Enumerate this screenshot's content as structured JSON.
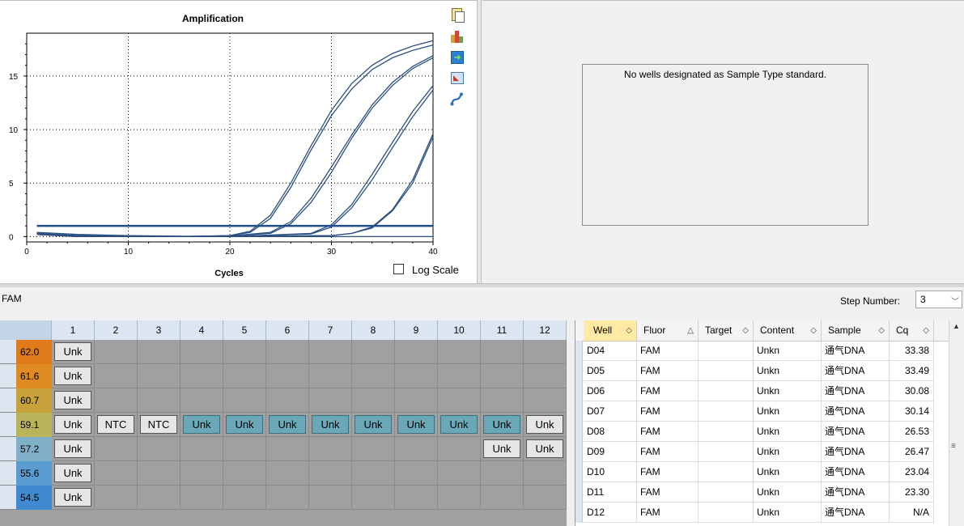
{
  "chart": {
    "title": "Amplification",
    "xlabel": "Cycles",
    "log_scale_label": "Log Scale",
    "log_scale_checked": false,
    "toolbar_icons": [
      "copy-icon",
      "chart-color-icon",
      "export-icon",
      "image-export-icon",
      "curve-tools-icon"
    ]
  },
  "chart_data": {
    "type": "line",
    "title": "Amplification",
    "xlabel": "Cycles",
    "ylabel": "",
    "xlim": [
      0,
      40
    ],
    "ylim": [
      -0.5,
      19
    ],
    "x_ticks": [
      "0",
      "10",
      "20",
      "30",
      "40"
    ],
    "y_ticks": [
      "0",
      "5",
      "10",
      "15"
    ],
    "grid": true,
    "log_scale": false,
    "threshold": 1.0,
    "line_color": "#2b4f7e",
    "series": [
      {
        "x": [
          1,
          5,
          10,
          15,
          20,
          22,
          24,
          26,
          28,
          30,
          32,
          34,
          36,
          38,
          40
        ],
        "y": [
          0.3,
          0.1,
          0,
          0,
          0.1,
          0.5,
          2.0,
          5.0,
          8.5,
          11.8,
          14.3,
          16.0,
          17.1,
          17.8,
          18.3
        ]
      },
      {
        "x": [
          1,
          5,
          10,
          15,
          20,
          22,
          24,
          26,
          28,
          30,
          32,
          34,
          36,
          38,
          40
        ],
        "y": [
          0.3,
          0.1,
          0,
          0,
          0.1,
          0.4,
          1.7,
          4.6,
          8.1,
          11.3,
          13.8,
          15.6,
          16.7,
          17.4,
          17.9
        ]
      },
      {
        "x": [
          1,
          5,
          10,
          15,
          20,
          24,
          26,
          28,
          30,
          32,
          34,
          36,
          38,
          40
        ],
        "y": [
          0.2,
          0.1,
          0,
          0,
          0.05,
          0.4,
          1.4,
          3.6,
          6.5,
          9.5,
          12.3,
          14.4,
          15.9,
          16.9
        ]
      },
      {
        "x": [
          1,
          5,
          10,
          15,
          20,
          24,
          26,
          28,
          30,
          32,
          34,
          36,
          38,
          40
        ],
        "y": [
          0.2,
          0.1,
          0,
          0,
          0.05,
          0.3,
          1.2,
          3.2,
          6.0,
          9.2,
          12.0,
          14.1,
          15.7,
          16.7
        ]
      },
      {
        "x": [
          1,
          5,
          10,
          15,
          20,
          28,
          30,
          32,
          34,
          36,
          38,
          40
        ],
        "y": [
          0.2,
          0,
          0,
          0,
          0,
          0.3,
          1.1,
          3.0,
          5.8,
          8.8,
          11.7,
          14.1
        ]
      },
      {
        "x": [
          1,
          5,
          10,
          15,
          20,
          28,
          30,
          32,
          34,
          36,
          38,
          40
        ],
        "y": [
          0.2,
          0,
          0,
          0,
          0,
          0.25,
          0.9,
          2.7,
          5.3,
          8.3,
          11.2,
          13.7
        ]
      },
      {
        "x": [
          1,
          5,
          10,
          15,
          20,
          30,
          32,
          34,
          36,
          38,
          40
        ],
        "y": [
          0.2,
          0,
          0,
          0,
          0,
          0.1,
          0.3,
          0.9,
          2.5,
          5.3,
          9.6
        ]
      },
      {
        "x": [
          1,
          5,
          10,
          15,
          20,
          30,
          32,
          34,
          36,
          38,
          40
        ],
        "y": [
          0.2,
          0,
          0,
          0,
          0,
          0.1,
          0.3,
          0.8,
          2.4,
          5.0,
          9.3
        ]
      },
      {
        "x": [
          1,
          5,
          10,
          20,
          30,
          40
        ],
        "y": [
          0.4,
          0.2,
          0.1,
          0,
          0,
          0
        ]
      }
    ]
  },
  "standard_pane": {
    "message": "No wells designated as Sample Type standard."
  },
  "fluor_bar": {
    "fluor": "FAM",
    "step_label": "Step Number:",
    "step_value": "3"
  },
  "plate": {
    "columns": [
      "1",
      "2",
      "3",
      "4",
      "5",
      "6",
      "7",
      "8",
      "9",
      "10",
      "11",
      "12"
    ],
    "rows": [
      {
        "temp": "62.0",
        "color": "#e07b1a",
        "wells": [
          "Unk",
          "",
          "",
          "",
          "",
          "",
          "",
          "",
          "",
          "",
          "",
          ""
        ]
      },
      {
        "temp": "61.6",
        "color": "#e08a22",
        "wells": [
          "Unk",
          "",
          "",
          "",
          "",
          "",
          "",
          "",
          "",
          "",
          "",
          ""
        ]
      },
      {
        "temp": "60.7",
        "color": "#c7a23a",
        "wells": [
          "Unk",
          "",
          "",
          "",
          "",
          "",
          "",
          "",
          "",
          "",
          "",
          ""
        ]
      },
      {
        "temp": "59.1",
        "color": "#b9b45a",
        "wells": [
          "Unk",
          "NTC",
          "NTC",
          "Unk",
          "Unk",
          "Unk",
          "Unk",
          "Unk",
          "Unk",
          "Unk",
          "Unk",
          "Unk"
        ]
      },
      {
        "temp": "57.2",
        "color": "#7fb0c8",
        "wells": [
          "Unk",
          "",
          "",
          "",
          "",
          "",
          "",
          "",
          "",
          "",
          "Unk",
          "Unk"
        ]
      },
      {
        "temp": "55.6",
        "color": "#5a9ccf",
        "wells": [
          "Unk",
          "",
          "",
          "",
          "",
          "",
          "",
          "",
          "",
          "",
          "",
          ""
        ]
      },
      {
        "temp": "54.5",
        "color": "#3f8ad0",
        "wells": [
          "Unk",
          "",
          "",
          "",
          "",
          "",
          "",
          "",
          "",
          "",
          "",
          ""
        ]
      }
    ],
    "blue_wells_row4": [
      3,
      4,
      5,
      6,
      7,
      8,
      9,
      10
    ]
  },
  "results_table": {
    "columns": [
      "Well",
      "Fluor",
      "Target",
      "Content",
      "Sample",
      "Cq"
    ],
    "rows": [
      [
        "D04",
        "FAM",
        "",
        "Unkn",
        "通气DNA",
        "33.38"
      ],
      [
        "D05",
        "FAM",
        "",
        "Unkn",
        "通气DNA",
        "33.49"
      ],
      [
        "D06",
        "FAM",
        "",
        "Unkn",
        "通气DNA",
        "30.08"
      ],
      [
        "D07",
        "FAM",
        "",
        "Unkn",
        "通气DNA",
        "30.14"
      ],
      [
        "D08",
        "FAM",
        "",
        "Unkn",
        "通气DNA",
        "26.53"
      ],
      [
        "D09",
        "FAM",
        "",
        "Unkn",
        "通气DNA",
        "26.47"
      ],
      [
        "D10",
        "FAM",
        "",
        "Unkn",
        "通气DNA",
        "23.04"
      ],
      [
        "D11",
        "FAM",
        "",
        "Unkn",
        "通气DNA",
        "23.30"
      ],
      [
        "D12",
        "FAM",
        "",
        "Unkn",
        "通气DNA",
        "N/A"
      ]
    ]
  }
}
